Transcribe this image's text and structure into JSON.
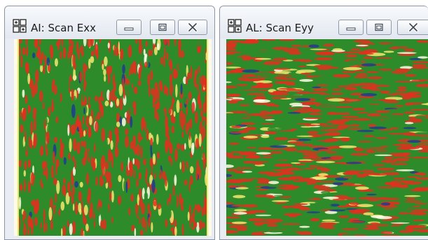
{
  "windows": [
    {
      "title": "AI: Scan Exx",
      "icon": "grid-app-icon",
      "controls": [
        "minimize-icon",
        "maximize-icon",
        "close-icon"
      ]
    },
    {
      "title": "AL: Scan Eyy",
      "icon": "grid-app-icon",
      "controls": [
        "minimize-icon",
        "maximize-icon",
        "close-icon"
      ]
    }
  ],
  "colors": {
    "map_green": "#2e8b2a",
    "map_red": "#e0301e",
    "map_yellow": "#f3e870",
    "map_white": "#fffbe6",
    "map_blue": "#1f3b8f",
    "titlebar": "#eef1f6",
    "window_border": "#8a94a3"
  }
}
